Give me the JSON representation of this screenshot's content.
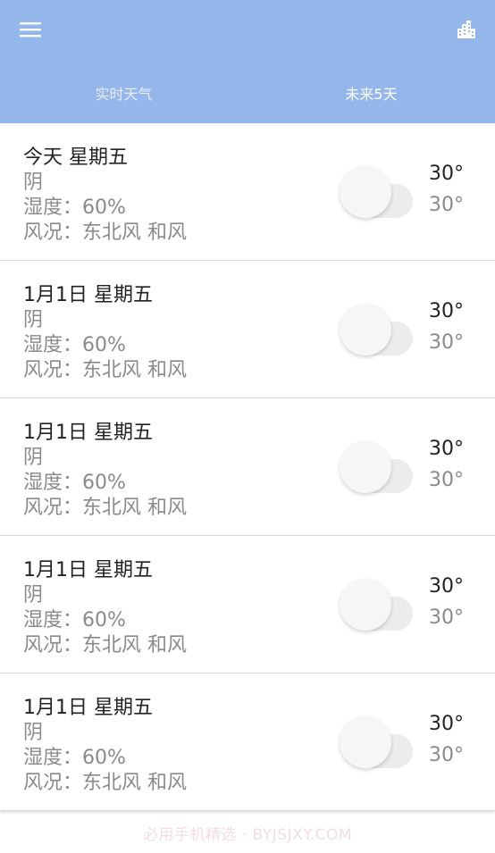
{
  "colors": {
    "appbar": "#94b6ea",
    "primary_text": "#222222",
    "secondary_text": "#8a8a8a"
  },
  "appbar": {
    "menu_icon": "menu-icon",
    "city_icon": "city-icon"
  },
  "tabs": [
    {
      "label": "实时天气",
      "active": false
    },
    {
      "label": "未来5天",
      "active": true
    }
  ],
  "forecast": [
    {
      "date": "今天 星期五",
      "condition": "阴",
      "humidity": "湿度：60%",
      "wind": "风况：东北风 和风",
      "high": "30°",
      "low": "30°"
    },
    {
      "date": "1月1日 星期五",
      "condition": "阴",
      "humidity": "湿度：60%",
      "wind": "风况：东北风 和风",
      "high": "30°",
      "low": "30°"
    },
    {
      "date": "1月1日 星期五",
      "condition": "阴",
      "humidity": "湿度：60%",
      "wind": "风况：东北风 和风",
      "high": "30°",
      "low": "30°"
    },
    {
      "date": "1月1日 星期五",
      "condition": "阴",
      "humidity": "湿度：60%",
      "wind": "风况：东北风 和风",
      "high": "30°",
      "low": "30°"
    },
    {
      "date": "1月1日 星期五",
      "condition": "阴",
      "humidity": "湿度：60%",
      "wind": "风况：东北风 和风",
      "high": "30°",
      "low": "30°"
    }
  ],
  "watermark": "必用手机精选 · BYJSJXY.COM"
}
